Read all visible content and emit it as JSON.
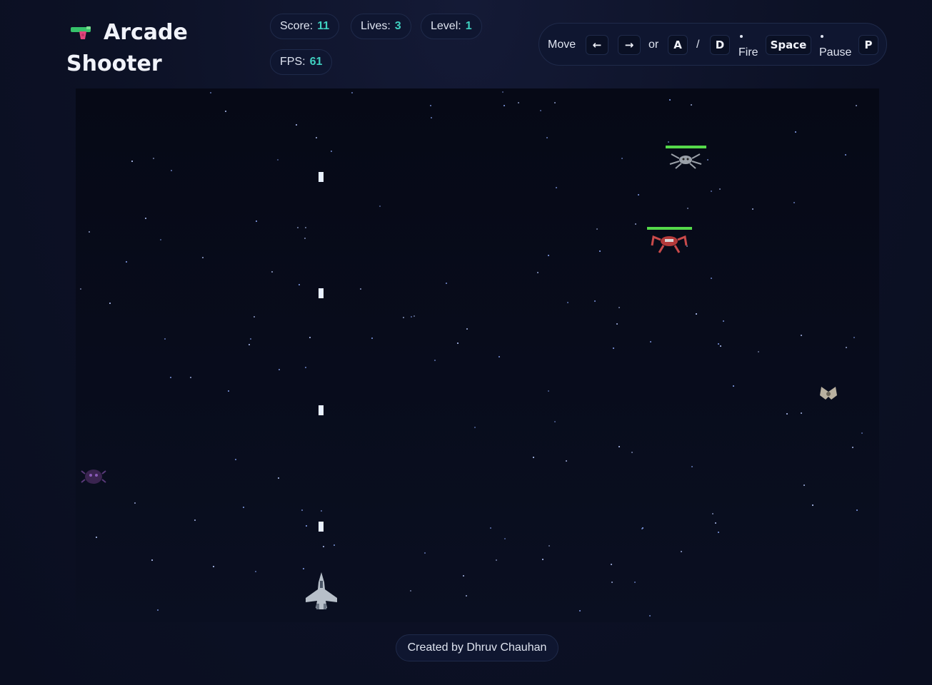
{
  "header": {
    "title": "Arcade Shooter",
    "title_icon": "water-gun-icon"
  },
  "stats": {
    "score_label": "Score:",
    "score": "11",
    "lives_label": "Lives:",
    "lives": "3",
    "level_label": "Level:",
    "level": "1",
    "fps_label": "FPS:",
    "fps": "61"
  },
  "controls": {
    "move_label": "Move",
    "left_key": "←",
    "right_key": "→",
    "or_label": "or",
    "a_key": "A",
    "slash": "/",
    "d_key": "D",
    "fire_label": "Fire",
    "space_key": "Space",
    "pause_label": "Pause",
    "p_key": "P"
  },
  "game": {
    "enemies": [
      {
        "name": "spider-drone-enemy",
        "health": 1.0,
        "color": "#9aa0a8"
      },
      {
        "name": "red-crab-enemy",
        "health": 1.0,
        "color": "#b33a3a"
      },
      {
        "name": "bat-wing-enemy",
        "color": "#b9b1a0"
      },
      {
        "name": "purple-beetle-enemy",
        "color": "#5a3a7a"
      }
    ],
    "player": {
      "name": "player-jet",
      "color": "#b7bfc9"
    },
    "bullet_color": "#e8f0ff",
    "health_bar_color": "#55d94a"
  },
  "footer": {
    "credit": "Created by Dhruv Chauhan"
  },
  "colors": {
    "accent": "#3fd0c0",
    "background": "#0d1228"
  }
}
